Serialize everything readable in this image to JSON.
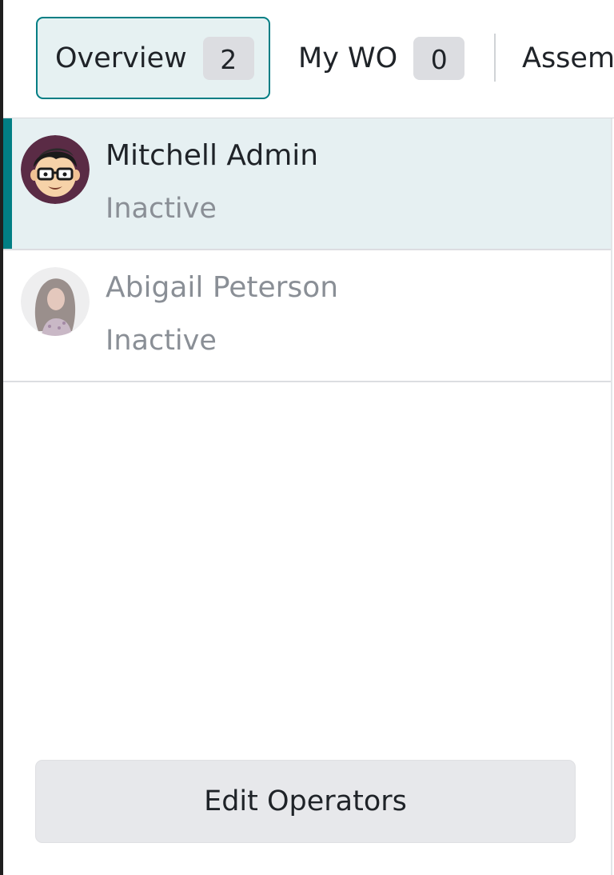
{
  "tabs": [
    {
      "label": "Overview",
      "count": "2",
      "active": true
    },
    {
      "label": "My WO",
      "count": "0",
      "active": false
    },
    {
      "label": "Assem",
      "count": null,
      "active": false
    }
  ],
  "operators": [
    {
      "name": "Mitchell Admin",
      "status": "Inactive",
      "selected": true
    },
    {
      "name": "Abigail Peterson",
      "status": "Inactive",
      "selected": false
    }
  ],
  "footer": {
    "edit_operators_label": "Edit Operators"
  },
  "colors": {
    "accent": "#017e84",
    "selected_row_bg": "#e6f0f2",
    "badge_bg": "#dcdde1",
    "muted_text": "#8a8f96"
  }
}
